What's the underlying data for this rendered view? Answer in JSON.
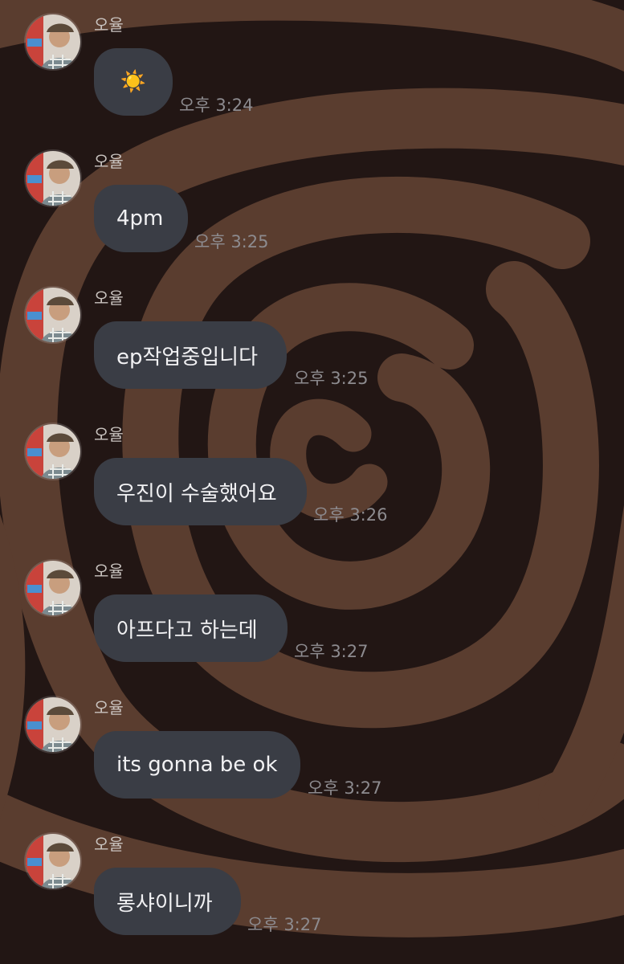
{
  "chat": {
    "messages": [
      {
        "sender": "오율",
        "text": "☀️",
        "time": "오후 3:24"
      },
      {
        "sender": "오율",
        "text": "4pm",
        "time": "오후 3:25"
      },
      {
        "sender": "오율",
        "text": "ep작업중입니다",
        "time": "오후 3:25"
      },
      {
        "sender": "오율",
        "text": "우진이 수술했어요",
        "time": "오후 3:26"
      },
      {
        "sender": "오율",
        "text": "아프다고 하는데",
        "time": "오후 3:27"
      },
      {
        "sender": "오율",
        "text": "its gonna be ok",
        "time": "오후 3:27"
      },
      {
        "sender": "오율",
        "text": "롱샤이니까",
        "time": "오후 3:27"
      }
    ]
  },
  "theme": {
    "background": "#221614",
    "swirl_color": "#5a3d2f",
    "bubble_color": "#3a3d45",
    "bubble_text": "#f1f1f3",
    "time_color": "#8d8b8f",
    "sender_color": "#c9c3bf",
    "avatar_icon": "profile-photo"
  }
}
